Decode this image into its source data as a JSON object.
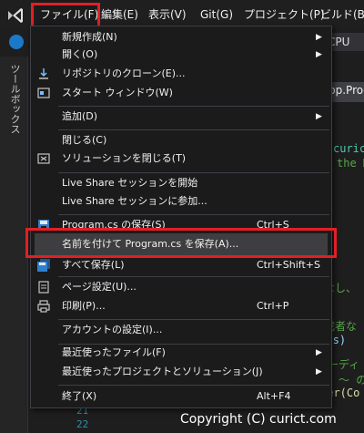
{
  "menubar": {
    "items": [
      {
        "label": "ファイル(F)"
      },
      {
        "label": "編集(E)"
      },
      {
        "label": "表示(V)"
      },
      {
        "label": "Git(G)"
      },
      {
        "label": "プロジェクト(P)"
      },
      {
        "label": "ビルド(B)"
      }
    ]
  },
  "toolbar": {
    "cpu_label": "CPU"
  },
  "toolbox": {
    "label": "ツールボックス"
  },
  "editor": {
    "tab_label": "pp.Progr",
    "lines": [
      {
        "text": "curict"
      },
      {
        "text": "the M"
      },
      {
        "text": "せなし、"
      },
      {
        "text": "作成者な"
      },
      {
        "text": "args)"
      },
      {
        "text": "ーディ"
      },
      {
        "text": "～ の"
      },
      {
        "text": "der(Co"
      }
    ],
    "line_numbers": [
      "21",
      "22"
    ]
  },
  "file_menu": {
    "items": [
      {
        "label": "新規作成(N)",
        "submenu": true
      },
      {
        "label": "開く(O)",
        "submenu": true
      },
      {
        "label": "リポジトリのクローン(E)..."
      },
      {
        "label": "スタート ウィンドウ(W)"
      },
      {
        "label": "追加(D)",
        "submenu": true
      },
      {
        "label": "閉じる(C)"
      },
      {
        "label": "ソリューションを閉じる(T)"
      },
      {
        "label": "Live Share セッションを開始"
      },
      {
        "label": "Live Share セッションに参加..."
      },
      {
        "label": "Program.cs の保存(S)",
        "shortcut": "Ctrl+S"
      },
      {
        "label": "名前を付けて Program.cs を保存(A)..."
      },
      {
        "label": "すべて保存(L)",
        "shortcut": "Ctrl+Shift+S"
      },
      {
        "label": "ページ設定(U)..."
      },
      {
        "label": "印刷(P)...",
        "shortcut": "Ctrl+P"
      },
      {
        "label": "アカウントの設定(I)..."
      },
      {
        "label": "最近使ったファイル(F)",
        "submenu": true
      },
      {
        "label": "最近使ったプロジェクトとソリューション(J)",
        "submenu": true
      },
      {
        "label": "終了(X)",
        "shortcut": "Alt+F4"
      }
    ],
    "submenu_arrow": "▶"
  },
  "watermark": "Copyright (C) curict.com",
  "colors": {
    "highlight_red": "#e21f26",
    "menu_bg": "#1b1b1c",
    "hover_bg": "#3e3e40"
  }
}
